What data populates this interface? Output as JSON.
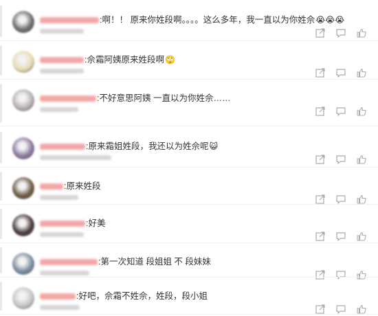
{
  "comments": [
    {
      "username": "████████",
      "text": "啊！！ 原来你姓段啊。。。。这么多年，我一直以为你姓佘",
      "emoji": "😭😭😭",
      "avatar_color": "#6e6e6e",
      "name_color": "#f3a7a7",
      "name_width": 86,
      "meta_width": 64
    },
    {
      "username": "████████",
      "text": "佘霜阿姨原来姓段啊",
      "emoji": "🙄",
      "avatar_color": "#e7dcb4",
      "name_color": "#f3a7a7",
      "name_width": 64,
      "meta_width": 64
    },
    {
      "username": "████████",
      "text": "不好意思阿姨 一直以为你姓佘……",
      "emoji": "",
      "avatar_color": "#b9b2b2",
      "name_color": "#f3a7a7",
      "name_width": 82,
      "meta_width": 56
    },
    {
      "username": "████████",
      "text": "原来霜姐姓段，我还以为姓佘呢",
      "emoji": "😺",
      "avatar_color": "#8c7aa0",
      "name_color": "#f3a7a7",
      "name_width": 66,
      "meta_width": 104
    },
    {
      "username": "████████",
      "text": "原来姓段",
      "emoji": "",
      "avatar_color": "#6a5a42",
      "name_color": "#f3a7a7",
      "name_width": 34,
      "meta_width": 56
    },
    {
      "username": "████████",
      "text": "好美",
      "emoji": "",
      "avatar_color": "#4a3a3a",
      "name_color": "#f3a7a7",
      "name_width": 66,
      "meta_width": 64
    },
    {
      "username": "████████",
      "text": "第一次知道 段姐姐 不 段妹妹",
      "emoji": "",
      "avatar_color": "#7b8ca0",
      "name_color": "#f3a7a7",
      "name_width": 84,
      "meta_width": 72
    },
    {
      "username": "████████",
      "text": "好吧，佘霜不姓佘，姓段，段小姐",
      "emoji": "",
      "avatar_color": "#c6c6c6",
      "name_color": "#f3a7a7",
      "name_width": 52,
      "meta_width": 58
    }
  ],
  "icons": [
    "share-icon",
    "comment-icon",
    "like-icon"
  ]
}
